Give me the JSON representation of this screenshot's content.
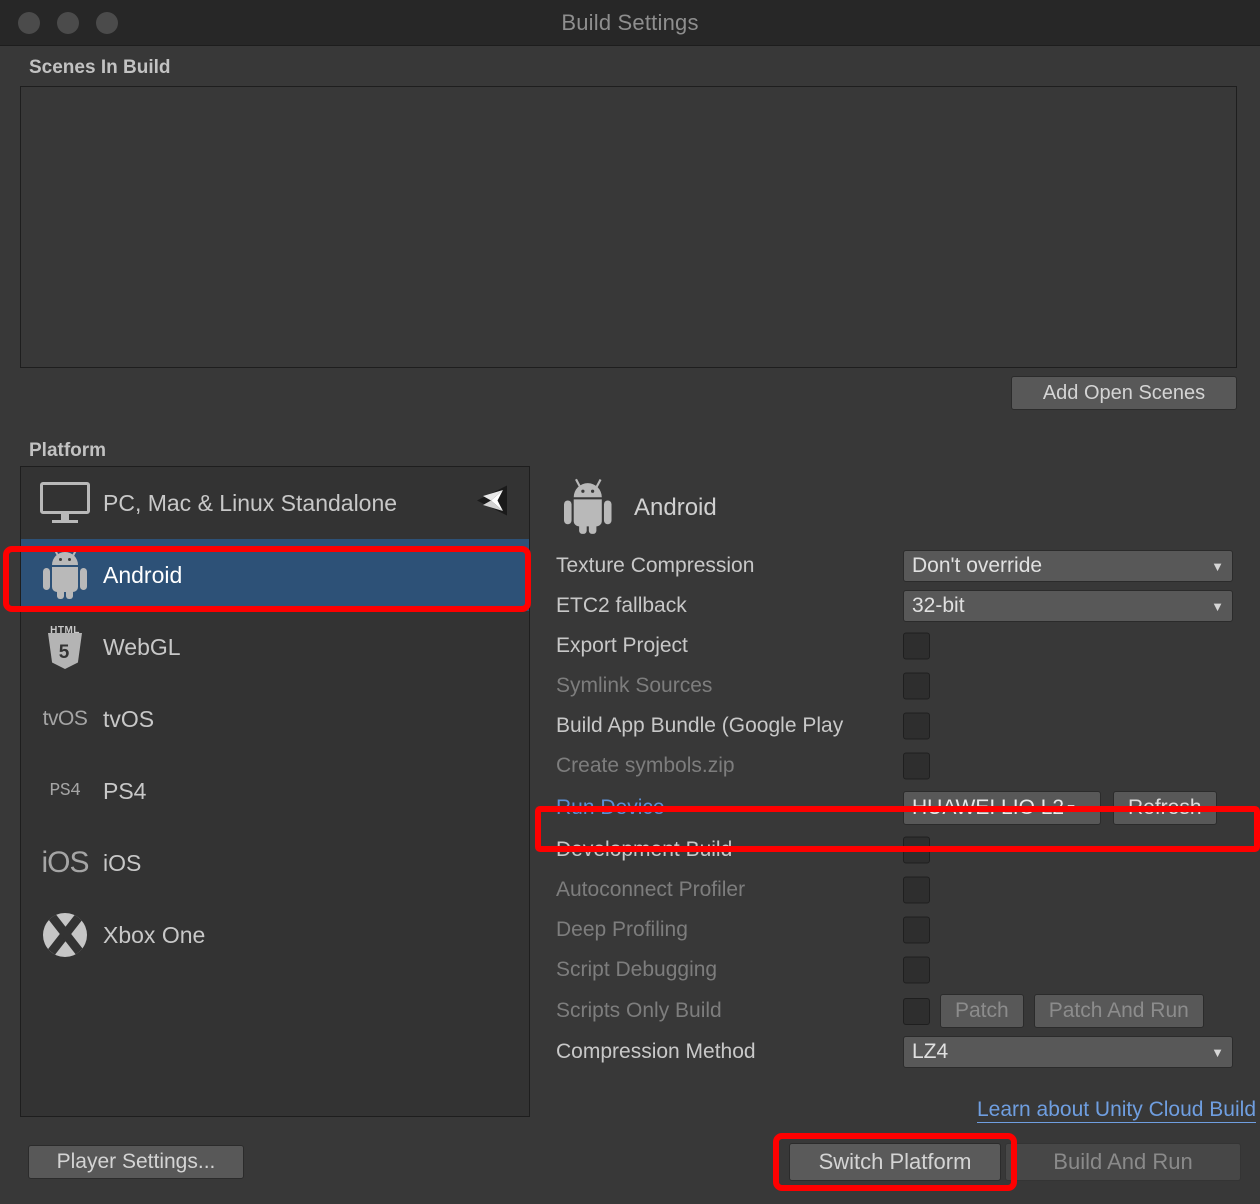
{
  "window": {
    "title": "Build Settings",
    "traffic_lights": [
      "close-button",
      "minimize-button",
      "zoom-button"
    ]
  },
  "scenes": {
    "header": "Scenes In Build",
    "items": [],
    "add_open_scenes_label": "Add Open Scenes"
  },
  "platform": {
    "header": "Platform",
    "items": [
      {
        "label": "PC, Mac & Linux Standalone",
        "icon": "monitor-icon",
        "selected": false,
        "current": true
      },
      {
        "label": "Android",
        "icon": "android-icon",
        "selected": true,
        "current": false
      },
      {
        "label": "WebGL",
        "icon": "html5-icon",
        "selected": false,
        "current": false
      },
      {
        "label": "tvOS",
        "icon": "tvos-icon",
        "selected": false,
        "current": false
      },
      {
        "label": "PS4",
        "icon": "ps4-icon",
        "selected": false,
        "current": false
      },
      {
        "label": "iOS",
        "icon": "ios-icon",
        "selected": false,
        "current": false
      },
      {
        "label": "Xbox One",
        "icon": "xbox-icon",
        "selected": false,
        "current": false
      }
    ],
    "icon_text": {
      "tvos": "tvOS",
      "ps4": "PS4",
      "ios": "iOS",
      "html5_tag": "HTML",
      "html5_five": "5"
    }
  },
  "settings": {
    "platform_title": "Android",
    "platform_icon": "android-icon",
    "rows": [
      {
        "label": "Texture Compression",
        "control": "dropdown",
        "value": "Don't override",
        "disabled": false
      },
      {
        "label": "ETC2 fallback",
        "control": "dropdown",
        "value": "32-bit",
        "disabled": false
      },
      {
        "label": "Export Project",
        "control": "checkbox",
        "checked": false,
        "disabled": false
      },
      {
        "label": "Symlink Sources",
        "control": "checkbox",
        "checked": false,
        "disabled": true
      },
      {
        "label": "Build App Bundle (Google Play",
        "control": "checkbox",
        "checked": false,
        "disabled": false
      },
      {
        "label": "Create symbols.zip",
        "control": "checkbox",
        "checked": false,
        "disabled": true
      },
      {
        "label": "Run Device",
        "control": "device",
        "value": "HUAWEI LIO L2",
        "button": "Refresh",
        "highlighted": true
      },
      {
        "label": "Development Build",
        "control": "checkbox",
        "checked": false,
        "disabled": false
      },
      {
        "label": "Autoconnect Profiler",
        "control": "checkbox",
        "checked": false,
        "disabled": true
      },
      {
        "label": "Deep Profiling",
        "control": "checkbox",
        "checked": false,
        "disabled": true
      },
      {
        "label": "Script Debugging",
        "control": "checkbox",
        "checked": false,
        "disabled": true
      },
      {
        "label": "Scripts Only Build",
        "control": "checkbox-patch",
        "checked": false,
        "disabled": true,
        "patch": "Patch",
        "patch_and_run": "Patch And Run"
      },
      {
        "label": "Compression Method",
        "control": "dropdown",
        "value": "LZ4",
        "disabled": false
      }
    ],
    "cloud_build_link": "Learn about Unity Cloud Build"
  },
  "footer": {
    "player_settings_label": "Player Settings...",
    "switch_platform_label": "Switch Platform",
    "build_and_run_label": "Build And Run"
  },
  "colors": {
    "window_bg": "#383838",
    "titlebar_bg": "#272727",
    "selected_blue": "#2d5177",
    "annotation_red": "#fe0000",
    "link_blue": "#6f9ee0",
    "run_device_label_blue": "#5b8fd4"
  }
}
